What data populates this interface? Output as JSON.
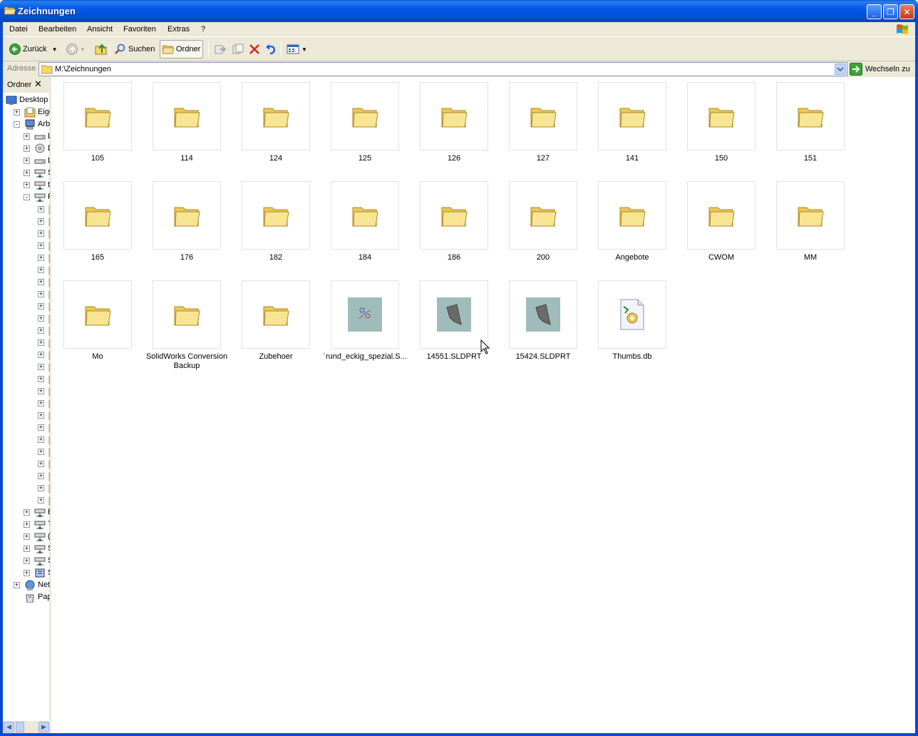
{
  "window": {
    "title": "Zeichnungen"
  },
  "menu": [
    "Datei",
    "Bearbeiten",
    "Ansicht",
    "Favoriten",
    "Extras",
    "?"
  ],
  "toolbar": {
    "back_label": "Zurück",
    "search_label": "Suchen",
    "folders_label": "Ordner"
  },
  "address": {
    "label": "Adresse",
    "path": "M:\\Zeichnungen",
    "go_label": "Wechseln zu"
  },
  "left_pane": {
    "header": "Ordner",
    "tree": [
      {
        "label": "Desktop",
        "icon": "desktop-icon",
        "level": 0,
        "expander": ""
      },
      {
        "label": "Eigen",
        "icon": "my-documents-icon",
        "level": 1,
        "expander": "+"
      },
      {
        "label": "Arbe",
        "icon": "my-computer-icon",
        "level": 1,
        "expander": "-"
      },
      {
        "label": "L",
        "icon": "drive-icon",
        "level": 2,
        "expander": "+"
      },
      {
        "label": "D",
        "icon": "cd-drive-icon",
        "level": 2,
        "expander": "+"
      },
      {
        "label": "L",
        "icon": "drive-icon",
        "level": 2,
        "expander": "+"
      },
      {
        "label": "S",
        "icon": "network-drive-icon",
        "level": 2,
        "expander": "+"
      },
      {
        "label": "t",
        "icon": "network-drive-icon",
        "level": 2,
        "expander": "+"
      },
      {
        "label": "F",
        "icon": "network-drive-icon",
        "level": 2,
        "expander": "-"
      },
      {
        "label": "",
        "icon": "folder-icon",
        "level": 3,
        "expander": "+"
      },
      {
        "label": "",
        "icon": "folder-icon",
        "level": 3,
        "expander": "+"
      },
      {
        "label": "",
        "icon": "folder-icon",
        "level": 3,
        "expander": "+"
      },
      {
        "label": "",
        "icon": "folder-icon",
        "level": 3,
        "expander": "+"
      },
      {
        "label": "",
        "icon": "folder-icon",
        "level": 3,
        "expander": "+"
      },
      {
        "label": "",
        "icon": "folder-icon",
        "level": 3,
        "expander": "+"
      },
      {
        "label": "",
        "icon": "folder-icon",
        "level": 3,
        "expander": "+"
      },
      {
        "label": "",
        "icon": "folder-icon",
        "level": 3,
        "expander": "+"
      },
      {
        "label": "",
        "icon": "folder-icon",
        "level": 3,
        "expander": "+"
      },
      {
        "label": "",
        "icon": "folder-icon",
        "level": 3,
        "expander": "+"
      },
      {
        "label": "",
        "icon": "folder-icon",
        "level": 3,
        "expander": "+"
      },
      {
        "label": "",
        "icon": "folder-icon",
        "level": 3,
        "expander": "+"
      },
      {
        "label": "",
        "icon": "folder-icon",
        "level": 3,
        "expander": "+"
      },
      {
        "label": "",
        "icon": "folder-icon",
        "level": 3,
        "expander": "+"
      },
      {
        "label": "",
        "icon": "folder-icon",
        "level": 3,
        "expander": "+"
      },
      {
        "label": "",
        "icon": "folder-icon",
        "level": 3,
        "expander": "+"
      },
      {
        "label": "",
        "icon": "folder-icon",
        "level": 3,
        "expander": "+"
      },
      {
        "label": "",
        "icon": "folder-icon",
        "level": 3,
        "expander": "+"
      },
      {
        "label": "",
        "icon": "folder-icon",
        "level": 3,
        "expander": "+"
      },
      {
        "label": "",
        "icon": "folder-icon",
        "level": 3,
        "expander": "+"
      },
      {
        "label": "",
        "icon": "folder-icon",
        "level": 3,
        "expander": "+"
      },
      {
        "label": "",
        "icon": "folder-icon",
        "level": 3,
        "expander": "+"
      },
      {
        "label": "",
        "icon": "folder-icon",
        "level": 3,
        "expander": "+"
      },
      {
        "label": "",
        "icon": "folder-icon",
        "level": 3,
        "expander": "+"
      },
      {
        "label": "",
        "icon": "folder-icon",
        "level": 3,
        "expander": "+"
      },
      {
        "label": "E",
        "icon": "network-drive-icon",
        "level": 2,
        "expander": "+"
      },
      {
        "label": "T",
        "icon": "network-drive-icon",
        "level": 2,
        "expander": "+"
      },
      {
        "label": "(",
        "icon": "network-drive-icon",
        "level": 2,
        "expander": "+"
      },
      {
        "label": "S",
        "icon": "network-drive-icon",
        "level": 2,
        "expander": "+"
      },
      {
        "label": "S",
        "icon": "network-drive-icon",
        "level": 2,
        "expander": "+"
      },
      {
        "label": "S",
        "icon": "control-panel-icon",
        "level": 2,
        "expander": "+"
      },
      {
        "label": "Netz",
        "icon": "network-places-icon",
        "level": 1,
        "expander": "+"
      },
      {
        "label": "Papi",
        "icon": "recycle-bin-icon",
        "level": 1,
        "expander": ""
      }
    ]
  },
  "items": [
    {
      "name": "105",
      "type": "folder"
    },
    {
      "name": "114",
      "type": "folder"
    },
    {
      "name": "124",
      "type": "folder"
    },
    {
      "name": "125",
      "type": "folder"
    },
    {
      "name": "126",
      "type": "folder"
    },
    {
      "name": "127",
      "type": "folder"
    },
    {
      "name": "141",
      "type": "folder"
    },
    {
      "name": "150",
      "type": "folder"
    },
    {
      "name": "151",
      "type": "folder"
    },
    {
      "name": "165",
      "type": "folder"
    },
    {
      "name": "176",
      "type": "folder"
    },
    {
      "name": "182",
      "type": "folder"
    },
    {
      "name": "184",
      "type": "folder"
    },
    {
      "name": "186",
      "type": "folder"
    },
    {
      "name": "200",
      "type": "folder"
    },
    {
      "name": "Angebote",
      "type": "folder"
    },
    {
      "name": "CWOM",
      "type": "folder"
    },
    {
      "name": "MM",
      "type": "folder"
    },
    {
      "name": "Mo",
      "type": "folder"
    },
    {
      "name": "SolidWorks Conversion Backup",
      "type": "folder"
    },
    {
      "name": "Zubehoer",
      "type": "folder"
    },
    {
      "name": "´rund_eckig_spezial.S...",
      "type": "assembly"
    },
    {
      "name": "14551.SLDPRT",
      "type": "part"
    },
    {
      "name": "15424.SLDPRT",
      "type": "part"
    },
    {
      "name": "Thumbs.db",
      "type": "db"
    }
  ]
}
